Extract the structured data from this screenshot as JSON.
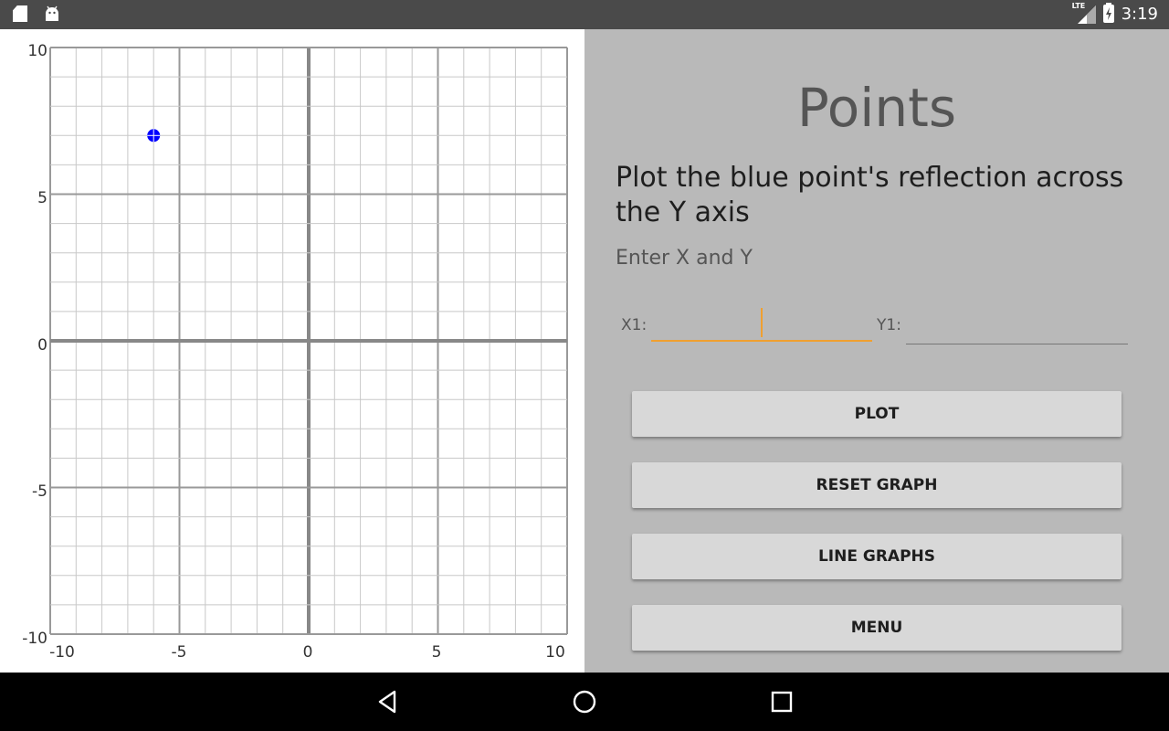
{
  "status_bar": {
    "time": "3:19",
    "network": "LTE",
    "left_icons": [
      "sd-card-icon",
      "android-icon"
    ],
    "right_icons": [
      "signal-icon",
      "battery-charging-icon"
    ]
  },
  "graph": {
    "y_ticks": [
      "10",
      "5",
      "0",
      "-5",
      "-10"
    ],
    "x_ticks": [
      "-10",
      "-5",
      "0",
      "5",
      "10"
    ]
  },
  "chart_data": {
    "type": "scatter",
    "xlim": [
      -10,
      10
    ],
    "ylim": [
      -10,
      10
    ],
    "grid": true,
    "minor_step": 1,
    "major_step": 5,
    "point_color": "#0000ff",
    "points": [
      {
        "x": -6,
        "y": 7
      }
    ]
  },
  "panel": {
    "title": "Points",
    "instruction": "Plot the blue point's reflection across the Y axis",
    "sub_instruction": "Enter X and Y",
    "x1_label": "X1:",
    "x1_value": "",
    "y1_label": "Y1:",
    "y1_value": "",
    "buttons": {
      "plot": "PLOT",
      "reset": "RESET GRAPH",
      "line_graphs": "LINE GRAPHS",
      "menu": "MENU"
    }
  },
  "nav_bar": {
    "icons": [
      "back-icon",
      "home-icon",
      "recents-icon"
    ]
  },
  "colors": {
    "accent": "#f0a030",
    "panel_bg": "#b9b9b9",
    "status_bar_bg": "#4a4a4a",
    "point": "#0000ff"
  }
}
